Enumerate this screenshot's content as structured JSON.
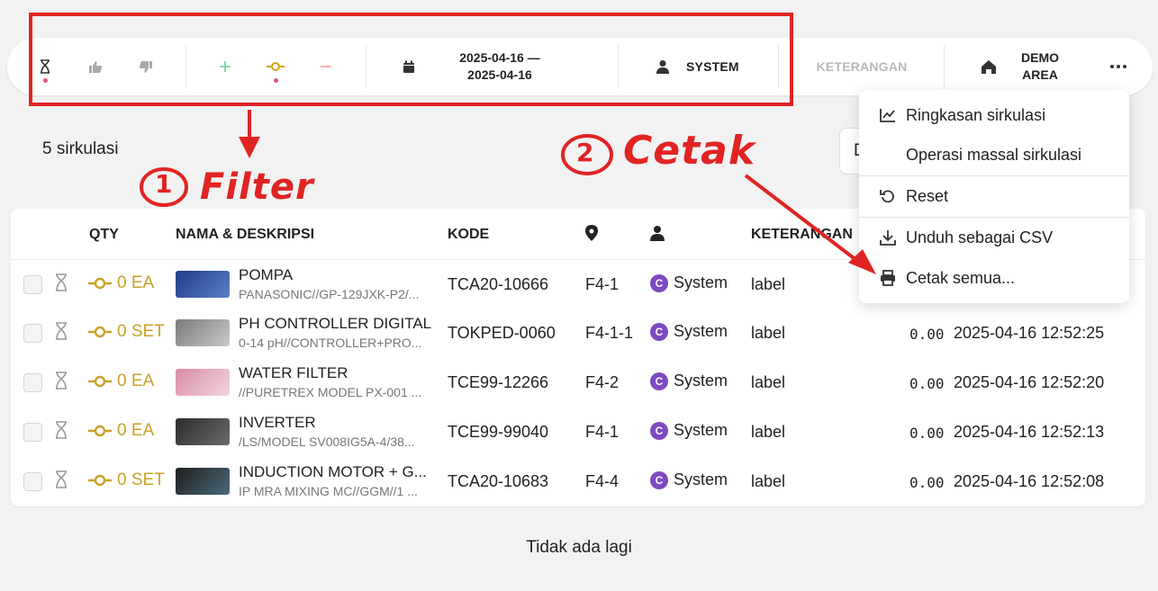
{
  "toolbar": {
    "date_line1": "2025-04-16 —",
    "date_line2": "2025-04-16",
    "user": "SYSTEM",
    "notes": "KETERANGAN",
    "area_line1": "DEMO",
    "area_line2": "AREA"
  },
  "summary": {
    "count": "5 sirkulasi",
    "behind_button": "D"
  },
  "table": {
    "headers": {
      "qty": "QTY",
      "name": "NAMA & DESKRIPSI",
      "code": "KODE",
      "notes": "KETERANGAN"
    },
    "rows": [
      {
        "qty": "0 EA",
        "name": "POMPA",
        "desc": "PANASONIC//GP-129JXK-P2/...",
        "code": "TCA20-10666",
        "loc": "F4-1",
        "user": "System",
        "note": "label",
        "num": "",
        "ts": ""
      },
      {
        "qty": "0 SET",
        "name": "PH CONTROLLER DIGITAL",
        "desc": "0-14 pH//CONTROLLER+PRO...",
        "code": "TOKPED-0060",
        "loc": "F4-1-1",
        "user": "System",
        "note": "label",
        "num": "0.00",
        "ts": "2025-04-16 12:52:25"
      },
      {
        "qty": "0 EA",
        "name": "WATER FILTER",
        "desc": "//PURETREX MODEL PX-001 ...",
        "code": "TCE99-12266",
        "loc": "F4-2",
        "user": "System",
        "note": "label",
        "num": "0.00",
        "ts": "2025-04-16 12:52:20"
      },
      {
        "qty": "0 EA",
        "name": "INVERTER",
        "desc": "/LS/MODEL SV008IG5A-4/38...",
        "code": "TCE99-99040",
        "loc": "F4-1",
        "user": "System",
        "note": "label",
        "num": "0.00",
        "ts": "2025-04-16 12:52:13"
      },
      {
        "qty": "0 SET",
        "name": "INDUCTION MOTOR + G...",
        "desc": "IP MRA MIXING MC//GGM//1 ...",
        "code": "TCA20-10683",
        "loc": "F4-4",
        "user": "System",
        "note": "label",
        "num": "0.00",
        "ts": "2025-04-16 12:52:08"
      }
    ]
  },
  "footer": "Tidak ada lagi",
  "menu": {
    "items": [
      {
        "label": "Ringkasan sirkulasi",
        "icon": "chart-icon"
      },
      {
        "label": "Operasi massal sirkulasi",
        "icon": ""
      },
      {
        "label": "Reset",
        "icon": "reset-icon"
      },
      {
        "label": "Unduh sebagai CSV",
        "icon": "download-icon"
      },
      {
        "label": "Cetak semua...",
        "icon": "printer-icon"
      }
    ]
  },
  "annotations": {
    "filter": "Filter",
    "filter_num": "1",
    "print": "Cetak",
    "print_num": "2"
  },
  "colors": {
    "accent_gold": "#c9a227",
    "annotation_red": "#e02424",
    "avatar_purple": "#7c4bc0",
    "pink_dot": "#e0566f"
  }
}
